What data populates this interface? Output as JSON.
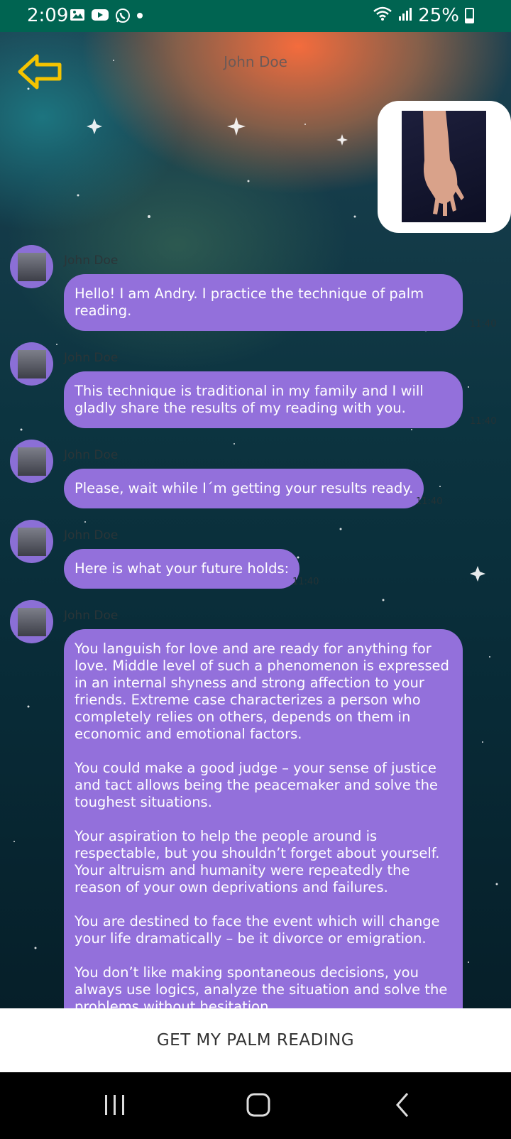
{
  "status_bar": {
    "time": "2:09",
    "battery": "25%",
    "icons": [
      "gallery-icon",
      "youtube-icon",
      "whatsapp-icon",
      "dot-icon",
      "wifi-icon",
      "signal-icon",
      "battery-icon"
    ]
  },
  "header": {
    "title": "John Doe",
    "back_icon": "back-arrow-icon"
  },
  "image_message": {
    "description_icon": "palm-photo"
  },
  "messages": [
    {
      "sender": "John Doe",
      "text": "Hello! I am Andry. I practice the technique of palm reading.",
      "time": "11:40"
    },
    {
      "sender": "John Doe",
      "text": "This technique is traditional in my family and I will gladly share the results of my reading with you.",
      "time": "11:40"
    },
    {
      "sender": "John Doe",
      "text": "Please, wait while I´m getting your results ready.",
      "time": "11:40"
    },
    {
      "sender": "John Doe",
      "text": "Here is what your future holds:",
      "time": "11:40"
    },
    {
      "sender": "John Doe",
      "text": "You languish for love and are ready for anything for love. Middle level of such a phenomenon is expressed in an internal shyness and strong affection to your friends. Extreme case characterizes a person who completely relies on others, depends on them in economic and emotional factors.\n\nYou could make a good judge – your sense of justice and tact allows being the peacemaker and solve the toughest situations.\n\nYour aspiration to help the people around is respectable, but you shouldn’t forget about yourself. Your altruism and humanity were repeatedly the reason of your own deprivations and failures.\n\nYou are destined to face the event which will change your life dramatically – be it divorce or emigration.\n\nYou don’t like making spontaneous decisions, you always use logics, analyze the situation and solve the problems without hesitation."
    }
  ],
  "cta": {
    "label": "GET MY PALM READING"
  },
  "nav_bar": {
    "buttons": [
      "recent-apps-icon",
      "home-icon",
      "back-icon"
    ]
  },
  "colors": {
    "status_bar": "#006451",
    "bubble": "#9370db",
    "accent_arrow": "#f5c400"
  }
}
